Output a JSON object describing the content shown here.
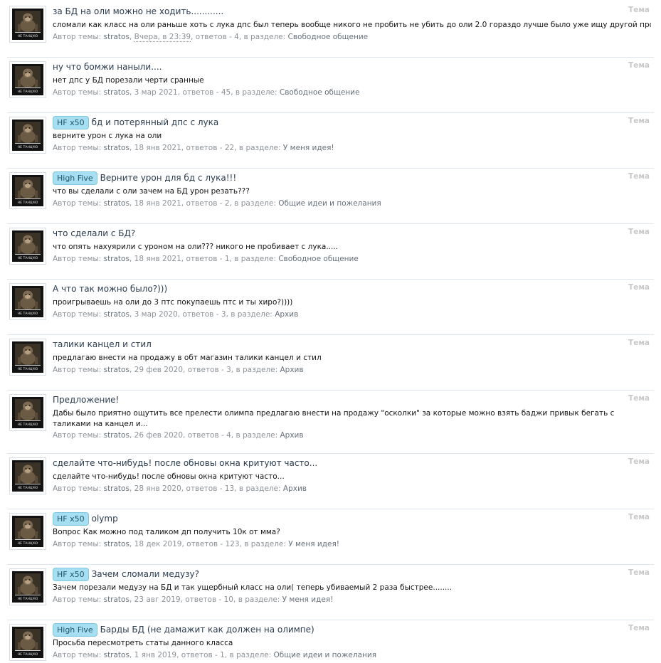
{
  "labels": {
    "author_prefix": "Автор темы:",
    "replies_prefix": "ответов -",
    "section_prefix": "в разделе:",
    "type_label": "Тема",
    "avatar_caption": "НЕ ТАНЦУЮ"
  },
  "results": [
    {
      "prefix": "",
      "title": "за БД на оли можно не ходить............",
      "snippet": "сломали как класс на оли раньше хоть с лука дпс был теперь вообще никого не пробить не убить до оли 2.0 гораздо лучше было уже ищу другой проект -...",
      "author": "stratos",
      "date": "Вчера, в 23:39",
      "replies": "4",
      "forum": "Свободное общение"
    },
    {
      "prefix": "",
      "title": "ну что бомжи наныли....",
      "snippet": "нет дпс у БД порезали черти сранные",
      "author": "stratos",
      "date": "3 мар 2021",
      "replies": "45",
      "forum": "Свободное общение"
    },
    {
      "prefix": "HF x50",
      "title": "бд и потерянный дпс с лука",
      "snippet": "верните урон с лука на оли",
      "author": "stratos",
      "date": "18 янв 2021",
      "replies": "22",
      "forum": "У меня идея!"
    },
    {
      "prefix": "High Five",
      "title": "Верните урон для бд с лука!!!",
      "snippet": "что вы сделали с оли зачем на БД урон резать???",
      "author": "stratos",
      "date": "18 янв 2021",
      "replies": "2",
      "forum": "Общие идеи и пожелания"
    },
    {
      "prefix": "",
      "title": "что сделали с БД?",
      "snippet": "что опять нахуярили с уроном на оли??? никого не пробивает с лука.....",
      "author": "stratos",
      "date": "18 янв 2021",
      "replies": "1",
      "forum": "Свободное общение"
    },
    {
      "prefix": "",
      "title": "А что так можно было?)))",
      "snippet": "проигрываешь на оли до 3 птс покупаешь птс и ты хиро?))))",
      "author": "stratos",
      "date": "3 мар 2020",
      "replies": "3",
      "forum": "Архив"
    },
    {
      "prefix": "",
      "title": "талики канцел и стил",
      "snippet": "предлагаю внести на продажу в обт магазин талики канцел и стил",
      "author": "stratos",
      "date": "29 фев 2020",
      "replies": "3",
      "forum": "Архив"
    },
    {
      "prefix": "",
      "title": "Предложение!",
      "snippet": "Дабы было приятно ощутить все прелести олимпа предлагаю внести на продажу \"осколки\" за которые можно взять баджи привык бегать с таликами на канцел и...",
      "author": "stratos",
      "date": "26 фев 2020",
      "replies": "4",
      "forum": "Архив"
    },
    {
      "prefix": "",
      "title": "сделайте что-нибудь! после обновы окна критуют часто...",
      "snippet": "сделайте что-нибудь! после обновы окна критуют часто...",
      "author": "stratos",
      "date": "28 янв 2020",
      "replies": "13",
      "forum": "Архив"
    },
    {
      "prefix": "HF x50",
      "title": "olymp",
      "snippet": "Вопрос Как можно под таликом дп получить 10к от мма?",
      "author": "stratos",
      "date": "18 дек 2019",
      "replies": "123",
      "forum": "У меня идея!"
    },
    {
      "prefix": "HF x50",
      "title": "Зачем сломали медузу?",
      "snippet": "Зачем порезали медузу на БД и так ущербный класс на оли( теперь убиваемый 2 раза быстрее........",
      "author": "stratos",
      "date": "23 авг 2019",
      "replies": "10",
      "forum": "У меня идея!"
    },
    {
      "prefix": "High Five",
      "title": "Барды БД (не дамажит как должен на олимпе)",
      "snippet": "Просьба пересмотреть статы данного класса",
      "author": "stratos",
      "date": "1 янв 2019",
      "replies": "1",
      "forum": "Общие идеи и пожелания"
    }
  ]
}
